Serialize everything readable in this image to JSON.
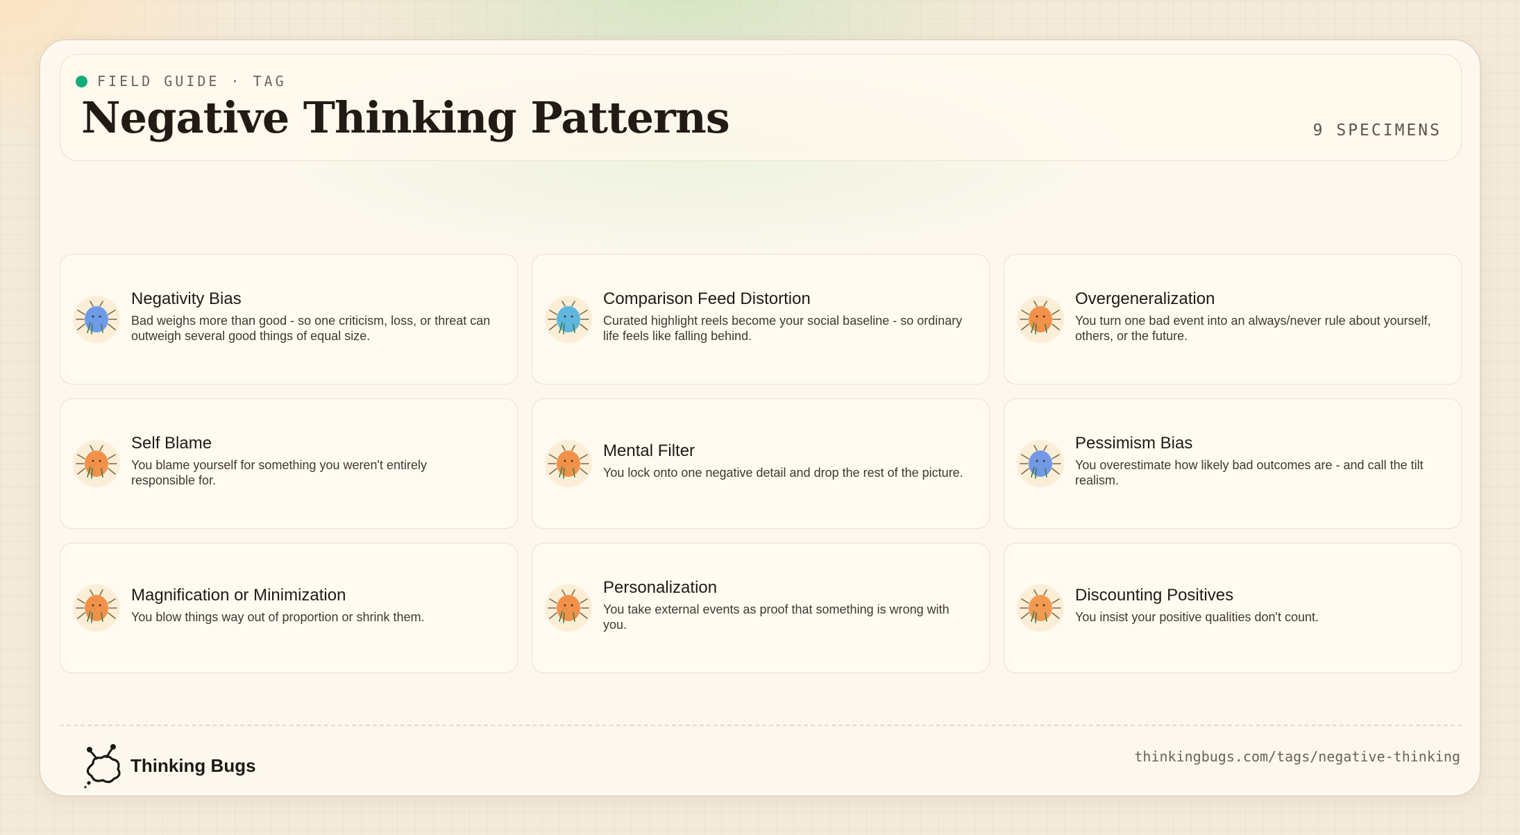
{
  "header": {
    "eyebrow": "FIELD GUIDE · TAG",
    "title": "Negative Thinking Patterns",
    "count": "9 SPECIMENS",
    "status_color": "#14ad78"
  },
  "cards": [
    {
      "title": "Negativity Bias",
      "desc": "Bad weighs more than good - so one criticism, loss, or threat can outweigh several good things of equal size.",
      "bug_color": "#6d9be8",
      "icon": "blue-bug-icon"
    },
    {
      "title": "Comparison Feed Distortion",
      "desc": "Curated highlight reels become your social baseline - so ordinary life feels like falling behind.",
      "bug_color": "#5fb6de",
      "icon": "cyan-bug-icon"
    },
    {
      "title": "Overgeneralization",
      "desc": "You turn one bad event into an always/never rule about yourself, others, or the future.",
      "bug_color": "#f2924a",
      "icon": "orange-bug-icon"
    },
    {
      "title": "Self Blame",
      "desc": "You blame yourself for something you weren't entirely responsible for.",
      "bug_color": "#f2924a",
      "icon": "orange-bug-icon"
    },
    {
      "title": "Mental Filter",
      "desc": "You lock onto one negative detail and drop the rest of the picture.",
      "bug_color": "#f2924a",
      "icon": "orange-bug-icon"
    },
    {
      "title": "Pessimism Bias",
      "desc": "You overestimate how likely bad outcomes are - and call the tilt realism.",
      "bug_color": "#7399e6",
      "icon": "blue-bug-icon"
    },
    {
      "title": "Magnification or Minimization",
      "desc": "You blow things way out of proportion or shrink them.",
      "bug_color": "#f2924a",
      "icon": "orange-bug-icon"
    },
    {
      "title": "Personalization",
      "desc": "You take external events as proof that something is wrong with you.",
      "bug_color": "#f2924a",
      "icon": "orange-bug-icon"
    },
    {
      "title": "Discounting Positives",
      "desc": "You insist your positive qualities don't count.",
      "bug_color": "#f39a52",
      "icon": "orange-bug-icon"
    }
  ],
  "footer": {
    "brand": "Thinking Bugs",
    "url": "thinkingbugs.com/tags/negative-thinking"
  }
}
